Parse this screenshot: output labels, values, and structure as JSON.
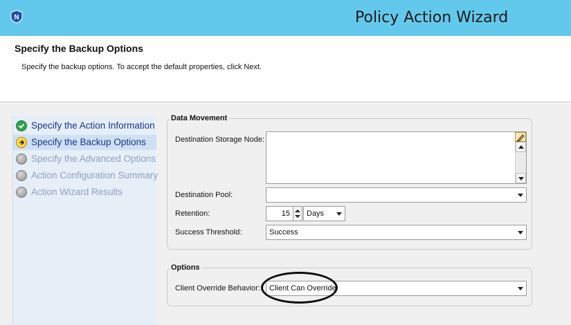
{
  "window": {
    "title": "Policy Action Wizard",
    "logo_icon": "networker-n-icon",
    "titlebar_color": "#63c9ec"
  },
  "header": {
    "title": "Specify the Backup Options",
    "subtitle": "Specify the backup options. To accept the default properties, click Next."
  },
  "steps": [
    {
      "label": "Specify the Action Information",
      "status": "done",
      "icon": "check-icon"
    },
    {
      "label": "Specify the Backup Options",
      "status": "current",
      "icon": "arrow-right-icon"
    },
    {
      "label": "Specify the Advanced Options",
      "status": "pending",
      "icon": "gray-circle-icon"
    },
    {
      "label": "Action Configuration Summary",
      "status": "pending",
      "icon": "gray-circle-icon"
    },
    {
      "label": "Action Wizard Results",
      "status": "pending",
      "icon": "gray-circle-icon"
    }
  ],
  "data_movement": {
    "title": "Data Movement",
    "destination_storage_node_label": "Destination Storage Node:",
    "destination_pool_label": "Destination Pool:",
    "destination_pool_value": "",
    "retention_label": "Retention:",
    "retention_value": "15",
    "retention_unit": "Days",
    "success_threshold_label": "Success Threshold:",
    "success_threshold_value": "Success"
  },
  "options": {
    "title": "Options",
    "client_override_label": "Client Override Behavior:",
    "client_override_value": "Client Can Override"
  }
}
